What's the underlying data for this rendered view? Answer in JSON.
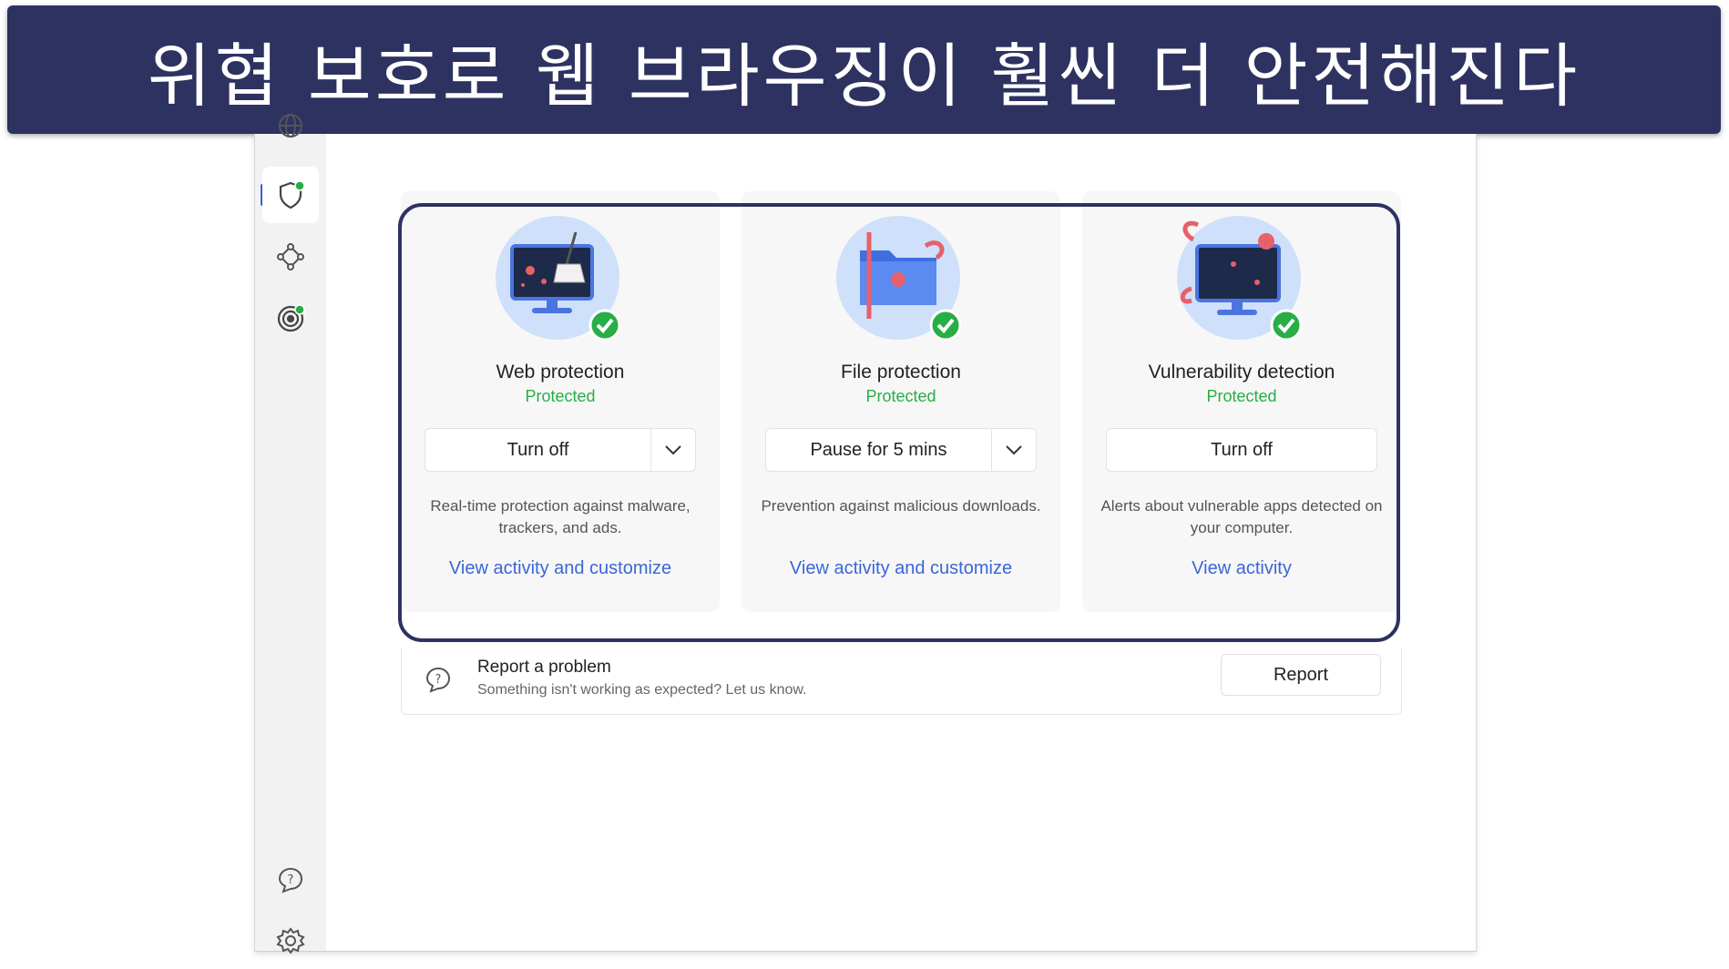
{
  "banner": {
    "text": "위협 보호로 웹 브라우징이 훨씬 더 안전해진다"
  },
  "sidebar": {
    "items": [
      {
        "icon": "globe-icon"
      },
      {
        "icon": "shield-icon",
        "active": true
      },
      {
        "icon": "network-icon"
      },
      {
        "icon": "target-icon"
      }
    ],
    "bottom": [
      {
        "icon": "help-icon"
      },
      {
        "icon": "gear-icon"
      }
    ]
  },
  "cards": [
    {
      "title": "Web protection",
      "status": "Protected",
      "button": "Turn off",
      "has_dropdown": true,
      "description": "Real-time protection against malware, trackers, and ads.",
      "link": "View activity and customize"
    },
    {
      "title": "File protection",
      "status": "Protected",
      "button": "Pause for 5 mins",
      "has_dropdown": true,
      "description": "Prevention against malicious downloads.",
      "link": "View activity and customize"
    },
    {
      "title": "Vulnerability detection",
      "status": "Protected",
      "button": "Turn off",
      "has_dropdown": false,
      "description": "Alerts about vulnerable apps detected on your computer.",
      "link": "View activity"
    }
  ],
  "report": {
    "title": "Report a problem",
    "subtitle": "Something isn't working as expected? Let us know.",
    "button": "Report"
  },
  "colors": {
    "banner_bg": "#2e3261",
    "status_green": "#27ae45",
    "link_blue": "#3a66d8",
    "accent_blue": "#3a5ed9"
  }
}
